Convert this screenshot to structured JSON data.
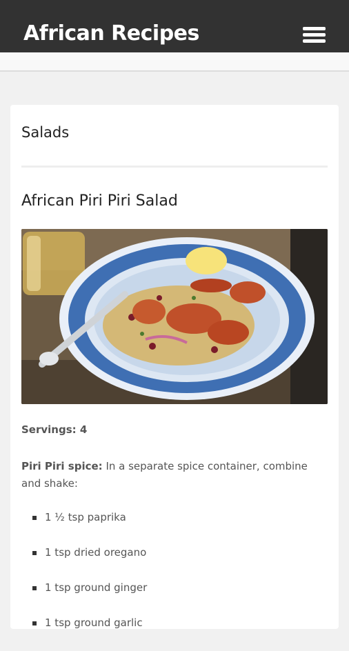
{
  "app": {
    "title": "African Recipes"
  },
  "section": {
    "title": "Salads"
  },
  "recipe": {
    "title": "African Piri Piri Salad",
    "servings": "Servings: 4",
    "spice_label": "Piri Piri spice:",
    "spice_text": " In a separate spice container, combine and shake:",
    "ingredients": [
      "1 ½ tsp paprika",
      "1 tsp dried oregano",
      "1 tsp ground ginger",
      "1 tsp ground garlic"
    ]
  },
  "colors": {
    "appbar": "#323232",
    "background": "#f1f1f1",
    "card": "#ffffff",
    "text": "#555555"
  },
  "icons": {
    "menu": "hamburger-menu-icon"
  }
}
